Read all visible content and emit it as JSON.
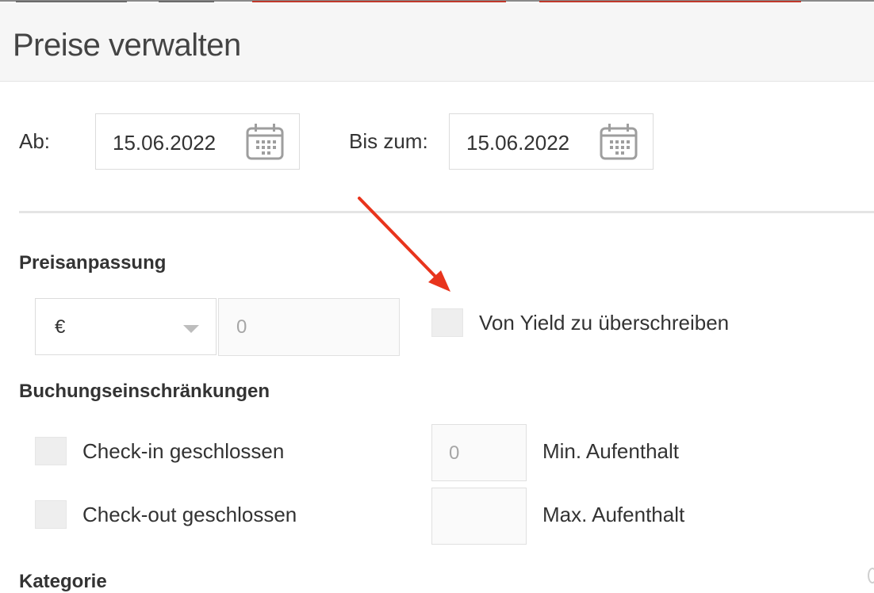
{
  "dialog": {
    "title": "Preise verwalten"
  },
  "dates": {
    "from_label": "Ab:",
    "from_value": "15.06.2022",
    "to_label": "Bis zum:",
    "to_value": "15.06.2022",
    "icon": "calendar-icon"
  },
  "price_adjustment": {
    "heading": "Preisanpassung",
    "currency_selected": "€",
    "amount_placeholder": "0",
    "override_yield_label": "Von Yield zu überschreiben",
    "override_yield_checked": false
  },
  "booking_restrictions": {
    "heading": "Buchungseinschränkungen",
    "checkin_closed_label": "Check-in geschlossen",
    "checkin_closed_checked": false,
    "checkout_closed_label": "Check-out geschlossen",
    "checkout_closed_checked": false,
    "min_stay_placeholder": "0",
    "min_stay_label": "Min. Aufenthalt",
    "max_stay_value": "",
    "max_stay_label": "Max. Aufenthalt"
  },
  "category": {
    "heading": "Kategorie"
  },
  "colors": {
    "annotation_arrow": "#e8341c",
    "field_border": "#dcdcdc",
    "disabled_input_bg": "#fafafa",
    "checkbox_bg": "#eeeeee",
    "header_bg": "#f6f6f6"
  }
}
